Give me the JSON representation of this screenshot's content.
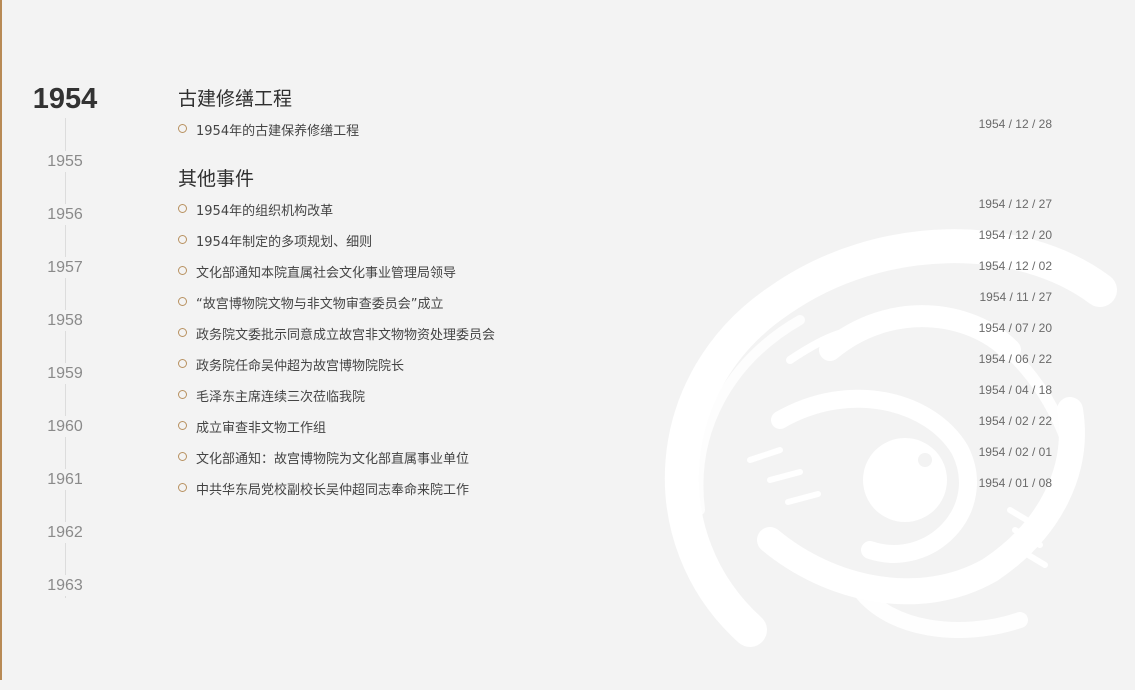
{
  "years": {
    "active": "1954",
    "list": [
      "1955",
      "1956",
      "1957",
      "1958",
      "1959",
      "1960",
      "1961",
      "1962",
      "1963"
    ]
  },
  "sections": [
    {
      "title": "古建修缮工程",
      "events": [
        {
          "title": "1954年的古建保养修缮工程",
          "date": "1954 / 12 / 28"
        }
      ]
    },
    {
      "title": "其他事件",
      "events": [
        {
          "title": "1954年的组织机构改革",
          "date": "1954 / 12 / 27"
        },
        {
          "title": "1954年制定的多项规划、细则",
          "date": "1954 / 12 / 20"
        },
        {
          "title": "文化部通知本院直属社会文化事业管理局领导",
          "date": "1954 / 12 / 02"
        },
        {
          "title": "“故宫博物院文物与非文物审查委员会”成立",
          "date": "1954 / 11 / 27"
        },
        {
          "title": "政务院文委批示同意成立故宫非文物物资处理委员会",
          "date": "1954 / 07 / 20"
        },
        {
          "title": "政务院任命吴仲超为故宫博物院院长",
          "date": "1954 / 06 / 22"
        },
        {
          "title": "毛泽东主席连续三次莅临我院",
          "date": "1954 / 04 / 18"
        },
        {
          "title": "成立审查非文物工作组",
          "date": "1954 / 02 / 22"
        },
        {
          "title": "文化部通知：故宫博物院为文化部直属事业单位",
          "date": "1954 / 02 / 01"
        },
        {
          "title": "中共华东局党校副校长吴仲超同志奉命来院工作",
          "date": "1954 / 01 / 08"
        }
      ]
    }
  ],
  "decor": {
    "watermark_icon": "dragon-medallion-icon",
    "accent_color": "#b88a55",
    "dot_color": "#b89160"
  }
}
